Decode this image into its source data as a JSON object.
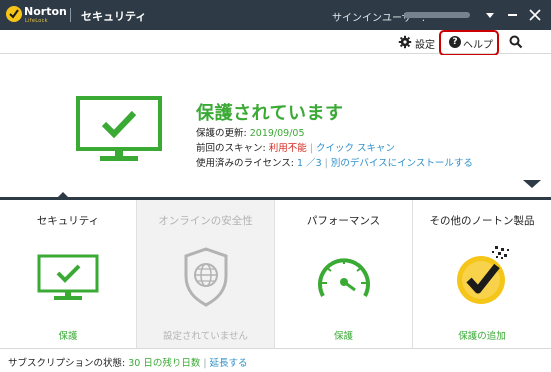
{
  "titlebar": {
    "brand": "Norton",
    "brand_sub": "LifeLock",
    "title": "セキュリティ",
    "signin_label": "サインインユーザー:",
    "colors": {
      "bg": "#2e3b47",
      "logo": "#f5c518"
    }
  },
  "subbar": {
    "settings_label": "設定",
    "help_label": "ヘルプ",
    "help_icon_glyph": "?"
  },
  "status": {
    "title": "保護されています",
    "update_label": "保護の更新:",
    "update_date": "2019/09/05",
    "scan_label": "前回のスキャン:",
    "scan_value": "利用不能",
    "quick_scan_link": "クイック スキャン",
    "license_label": "使用済みのライセンス:",
    "license_value": "1 ／3",
    "install_link": "別のデバイスにインストールする"
  },
  "tiles": [
    {
      "title": "セキュリティ",
      "status": "保護",
      "icon": "monitor-check-icon"
    },
    {
      "title": "オンラインの安全性",
      "status": "設定されていません",
      "icon": "shield-globe-icon"
    },
    {
      "title": "パフォーマンス",
      "status": "保護",
      "icon": "speedometer-icon"
    },
    {
      "title": "その他のノートン製品",
      "status": "保護の追加",
      "icon": "norton-badge-icon"
    }
  ],
  "footer": {
    "label": "サブスクリプションの状態:",
    "days": "30 日の残り日数",
    "renew_link": "延長する"
  },
  "colors": {
    "green": "#3aaa35",
    "red": "#d9261c",
    "link": "#2f8fc9",
    "disabled": "#b3b3b3",
    "highlight": "#cc0000"
  }
}
